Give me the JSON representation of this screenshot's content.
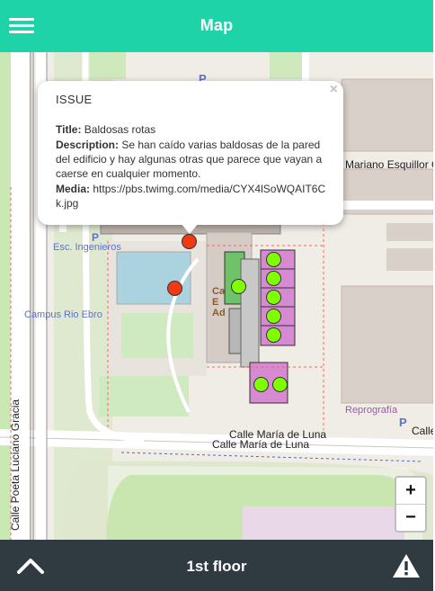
{
  "theme": {
    "accent": "#1dd3a7",
    "bottom_bar": "#2f3a41",
    "issue_marker": "#ef3a12",
    "room_marker": "#7fff00"
  },
  "header": {
    "title": "Map",
    "menu_icon": "hamburger-menu-icon"
  },
  "map": {
    "labels": {
      "esc_ingenieros": "Esc. Ingenieros",
      "campus": "Campus Rio Ebro",
      "street_esquillor": "Mariano Esquillor Gó",
      "street_maria_luna_1": "Calle María de Luna",
      "street_maria_luna_2": "Calle María de Luna",
      "street_poeta": "Calle Poeta Luciano Gracia",
      "street_calle_right": "Calle",
      "reprografia": "Reprografía",
      "building_fragment": "Ca E Ad",
      "parking_1": "P",
      "parking_2": "P",
      "parking_3": "P"
    }
  },
  "popup": {
    "close": "×",
    "title": "ISSUE",
    "title_label": "Title:",
    "title_value": "Baldosas rotas",
    "description_label": "Description:",
    "description_value": "Se han caído varias baldosas de la pared del edificio y hay algunas otras que parece que vayan a caerse en cualquier momento.",
    "media_label": "Media:",
    "media_value": "https://pbs.twimg.com/media/CYX4lSoWQAIT6Ck.jpg"
  },
  "zoom": {
    "in": "+",
    "out": "−"
  },
  "bottom": {
    "floor": "1st floor",
    "up_icon": "chevron-up-icon",
    "warning_icon": "warning-icon"
  }
}
